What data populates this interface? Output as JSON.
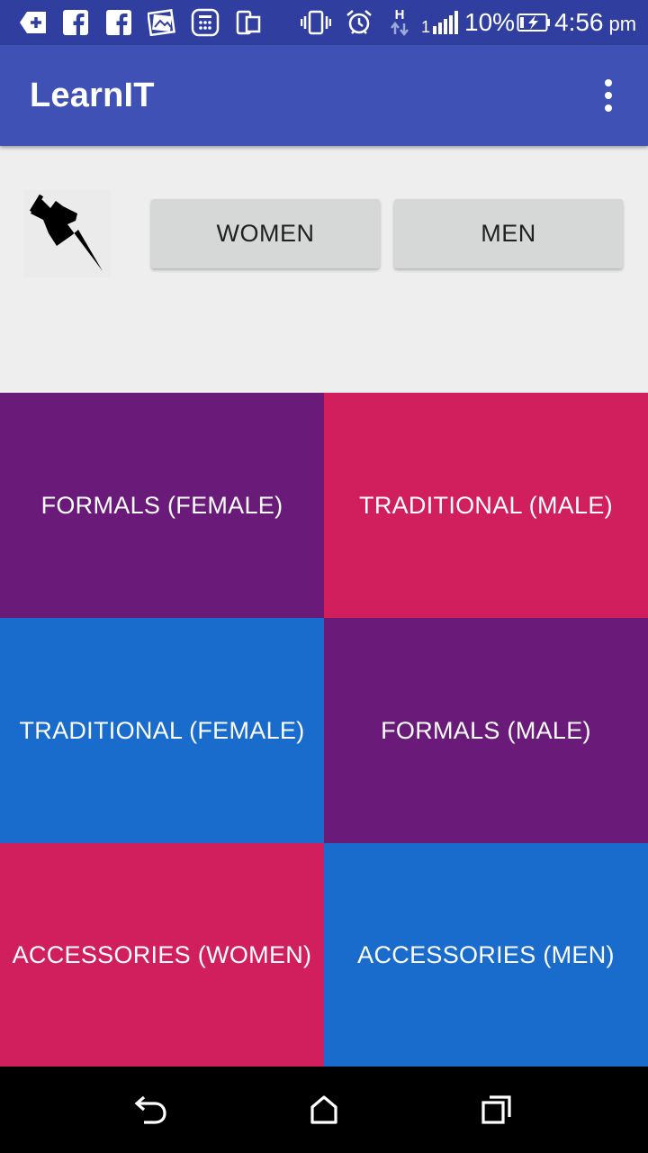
{
  "status_bar": {
    "battery_percent": "10%",
    "time": "4:56",
    "ampm": "pm",
    "network_letter": "H",
    "signal_digit": "1",
    "background_color": "#303f9f",
    "icons": [
      "add-notification-icon",
      "facebook-icon",
      "facebook-icon",
      "photo-stack-icon",
      "calculator-icon",
      "cast-device-icon",
      "vibrate-icon",
      "alarm-icon",
      "data-transfer-icon",
      "signal-icon",
      "battery-charging-icon"
    ]
  },
  "app_bar": {
    "title": "LearnIT",
    "background_color": "#3f51b5",
    "menu_icon": "more-vert-icon"
  },
  "controls": {
    "pin_icon": "pushpin-icon",
    "women_label": "WOMEN",
    "men_label": "MEN",
    "button_color": "#d6d7d7"
  },
  "tiles": [
    {
      "label": "FORMALS (FEMALE)",
      "color": "#6a1b7a"
    },
    {
      "label": "TRADITIONAL (MALE)",
      "color": "#d01f5c"
    },
    {
      "label": "TRADITIONAL (FEMALE)",
      "color": "#1a6ccc"
    },
    {
      "label": "FORMALS (MALE)",
      "color": "#6a1b7a"
    },
    {
      "label": "ACCESSORIES (WOMEN)",
      "color": "#d01f5c"
    },
    {
      "label": "ACCESSORIES (MEN)",
      "color": "#1a6ccc"
    }
  ],
  "nav_bar": {
    "back_icon": "back-icon",
    "home_icon": "home-icon",
    "recents_icon": "recents-icon"
  }
}
